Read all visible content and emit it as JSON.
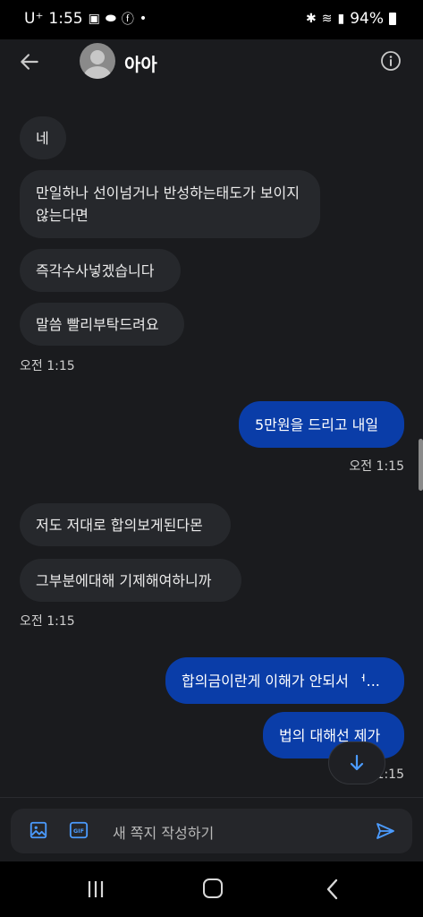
{
  "status_bar": {
    "carrier": "U⁺",
    "time": "1:55",
    "battery": "94%"
  },
  "header": {
    "contact_name": "아아"
  },
  "messages": [
    {
      "dir": "in",
      "text": "네"
    },
    {
      "dir": "in",
      "text": "만일하나 선이넘거나 반성하는태도가 보이지 않는다면"
    },
    {
      "dir": "in",
      "text": "즉각수사넣겠습니다"
    },
    {
      "dir": "in",
      "text": "말씀 빨리부탁드려요"
    },
    {
      "dir": "out",
      "text": "5만원을 드리고 내일"
    },
    {
      "dir": "in",
      "text": "저도 저대로 합의보게된다몬"
    },
    {
      "dir": "in",
      "text": "그부분에대해 기제해여하니까"
    },
    {
      "dir": "out",
      "text": "합의금이란게 이해가 안되서 ᅥ..."
    },
    {
      "dir": "out",
      "text": "법의 대해선 제가"
    }
  ],
  "timestamps": [
    "오전 1:15",
    "오전 1:15",
    "오전 1:15",
    "1:15"
  ],
  "composer": {
    "placeholder": "새 쪽지 작성하기",
    "gif_label": "GIF"
  },
  "colors": {
    "background": "#1a1b1e",
    "incoming_bubble": "#26282c",
    "outgoing_bubble": "#0a3da8",
    "accent": "#4b9bff"
  }
}
